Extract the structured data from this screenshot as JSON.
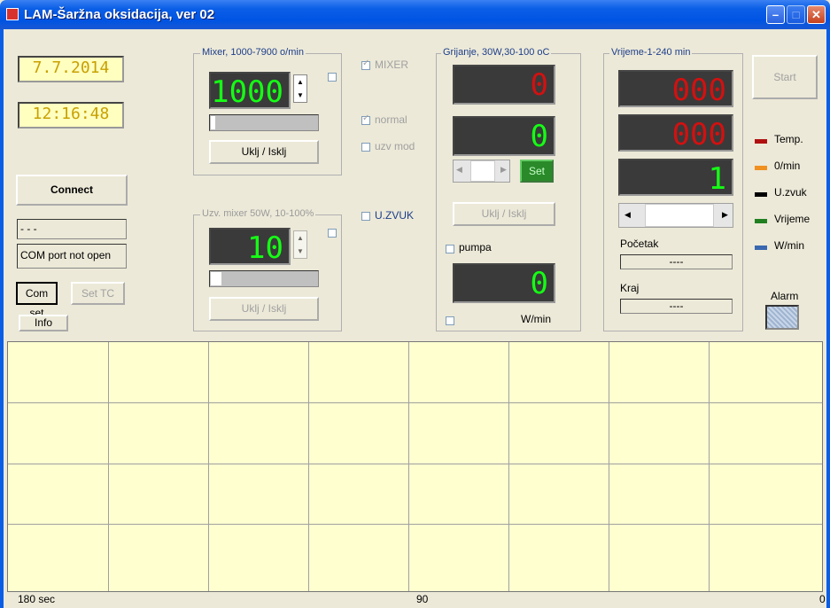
{
  "window": {
    "title": "LAM-Šaržna oksidacija, ver 02"
  },
  "left": {
    "date": "7.7.2014",
    "time": "12:16:48",
    "connect_label": "Connect",
    "status_top": "- - -",
    "status_msg": "COM port not open",
    "com_set_label": "Com set",
    "set_tc_label": "Set TC",
    "info_label": "Info"
  },
  "mixer": {
    "group_label": "Mixer, 1000-7900  o/min",
    "value": "1000",
    "progress": 0.02,
    "toggle_label": "Uklj / Isklj"
  },
  "uzv_mixer": {
    "group_label": "Uzv. mixer 50W, 10-100%",
    "value": "10",
    "progress": 0.1,
    "toggle_label": "Uklj / Isklj"
  },
  "mode": {
    "mixer_label": "MIXER",
    "normal_label": "normal",
    "uzv_mod_label": "uzv mod",
    "uzvuk_label": "U.ZVUK"
  },
  "heating": {
    "group_label": "Grijanje, 30W,30-100 oC",
    "actual": "0",
    "setpoint": "0",
    "set_label": "Set",
    "toggle_label": "Uklj / Isklj",
    "pump_label": "pumpa",
    "power": "0",
    "power_unit": "W/min"
  },
  "time": {
    "group_label": "Vrijeme-1-240 min",
    "display1": "000",
    "display2": "000",
    "setpoint": "1",
    "start_label_caption": "Početak",
    "start_value": "----",
    "end_label_caption": "Kraj",
    "end_value": "----",
    "slider": 0.05
  },
  "right": {
    "start_label": "Start",
    "alarm_label": "Alarm",
    "legend": [
      {
        "label": "Temp.",
        "color": "#b01010"
      },
      {
        "label": "0/min",
        "color": "#f09020"
      },
      {
        "label": "U.zvuk",
        "color": "#000000"
      },
      {
        "label": "Vrijeme",
        "color": "#208020"
      },
      {
        "label": "W/min",
        "color": "#3a68b0"
      }
    ]
  },
  "plot": {
    "x_left": "180 sec",
    "x_mid": "90",
    "x_right": "0"
  }
}
